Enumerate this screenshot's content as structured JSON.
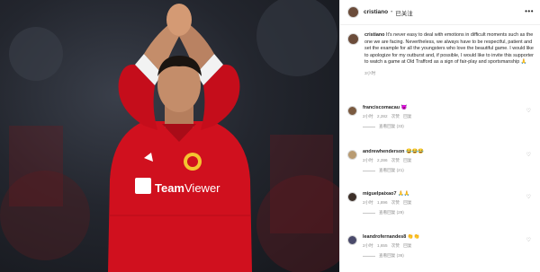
{
  "header": {
    "username": "cristiano",
    "separator": "•",
    "follow_label": "已关注",
    "more_icon": "more-horizontal-icon"
  },
  "caption": {
    "username": "cristiano",
    "text": "It's never easy to deal with emotions in difficult moments such as the one we are facing. Nevertheless, we always have to be respectful, patient and set the example for all the youngsters who love the beautiful game. I would like to apologize for my outburst and, if possible, I would like to invite this supporter to watch a game at Old Trafford as a sign of fair-play and sportsmanship 🙏",
    "time": "3小时"
  },
  "comments": [
    {
      "username": "franciscomacau",
      "text": "😈",
      "time": "2小时",
      "likes": "2,282 次赞",
      "reply": "回复",
      "replies": "查看回复 (33)"
    },
    {
      "username": "andrewhenderson",
      "text": "😂😂😂",
      "time": "2小时",
      "likes": "2,286 次赞",
      "reply": "回复",
      "replies": "查看回复 (21)"
    },
    {
      "username": "miguelpaixao7",
      "text": "🙏🙏",
      "time": "2小时",
      "likes": "1,896 次赞",
      "reply": "回复",
      "replies": "查看回复 (29)"
    },
    {
      "username": "leandrofernandes8",
      "text": "👏👏",
      "time": "2小时",
      "likes": "1,655 次赞",
      "reply": "回复",
      "replies": "查看回复 (36)"
    }
  ],
  "photo": {
    "sponsor": "TeamViewer",
    "kit_color": "#d0101e",
    "background_color": "#1b1d23"
  }
}
